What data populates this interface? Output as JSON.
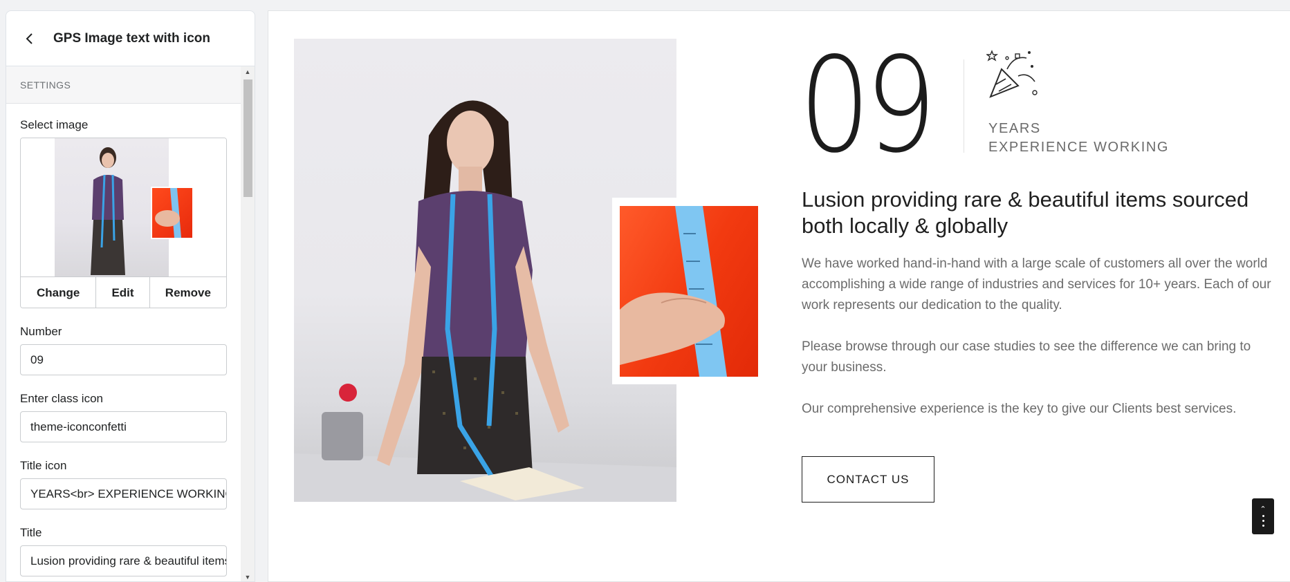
{
  "panel": {
    "title": "GPS Image text with icon",
    "section_label": "SETTINGS",
    "image_field": {
      "label": "Select image",
      "buttons": {
        "change": "Change",
        "edit": "Edit",
        "remove": "Remove"
      }
    },
    "number_field": {
      "label": "Number",
      "value": "09"
    },
    "class_icon_field": {
      "label": "Enter class icon",
      "value": "theme-iconconfetti"
    },
    "title_icon_field": {
      "label": "Title icon",
      "value": "YEARS<br> EXPERIENCE WORKING"
    },
    "title_field": {
      "label": "Title",
      "value": "Lusion providing rare & beautiful items sourced both locally & globally"
    }
  },
  "preview": {
    "number": "09",
    "icon": "confetti-icon",
    "icon_title_line1": "YEARS",
    "icon_title_line2": "EXPERIENCE WORKING",
    "title": "Lusion providing rare & beautiful items sourced both locally & globally",
    "paragraphs": [
      "We have worked hand-in-hand with a large scale of customers all over the world accomplishing a wide range of industries and services for 10+ years. Each of our work represents our dedication to the quality.",
      "Please browse through our case studies to see the difference we can bring to your business.",
      "Our comprehensive experience is the key to give our Clients best services."
    ],
    "button_label": "CONTACT US"
  },
  "colors": {
    "accent_red": "#f23a10",
    "tape_blue": "#3aa3e6",
    "blouse_purple": "#5b3f6e",
    "text_dark": "#1c1c1c",
    "text_muted": "#6b6b6b"
  }
}
